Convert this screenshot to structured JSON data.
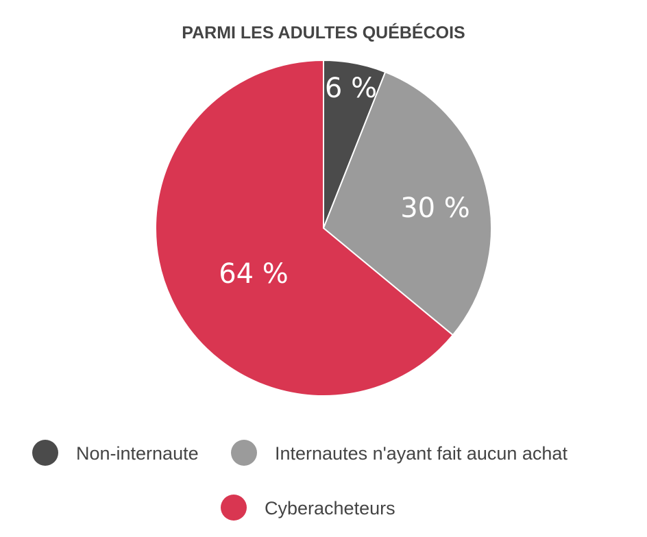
{
  "chart_data": {
    "type": "pie",
    "title": "PARMI LES ADULTES QUÉBÉCOIS",
    "categories": [
      "Non-internaute",
      "Internautes n'ayant fait aucun achat",
      "Cyberacheteurs"
    ],
    "values": [
      6,
      30,
      64
    ],
    "data_labels": [
      "6 %",
      "30 %",
      "64 %"
    ],
    "colors": [
      "#4b4b4b",
      "#9b9b9b",
      "#d93651"
    ],
    "legend_position": "bottom"
  }
}
